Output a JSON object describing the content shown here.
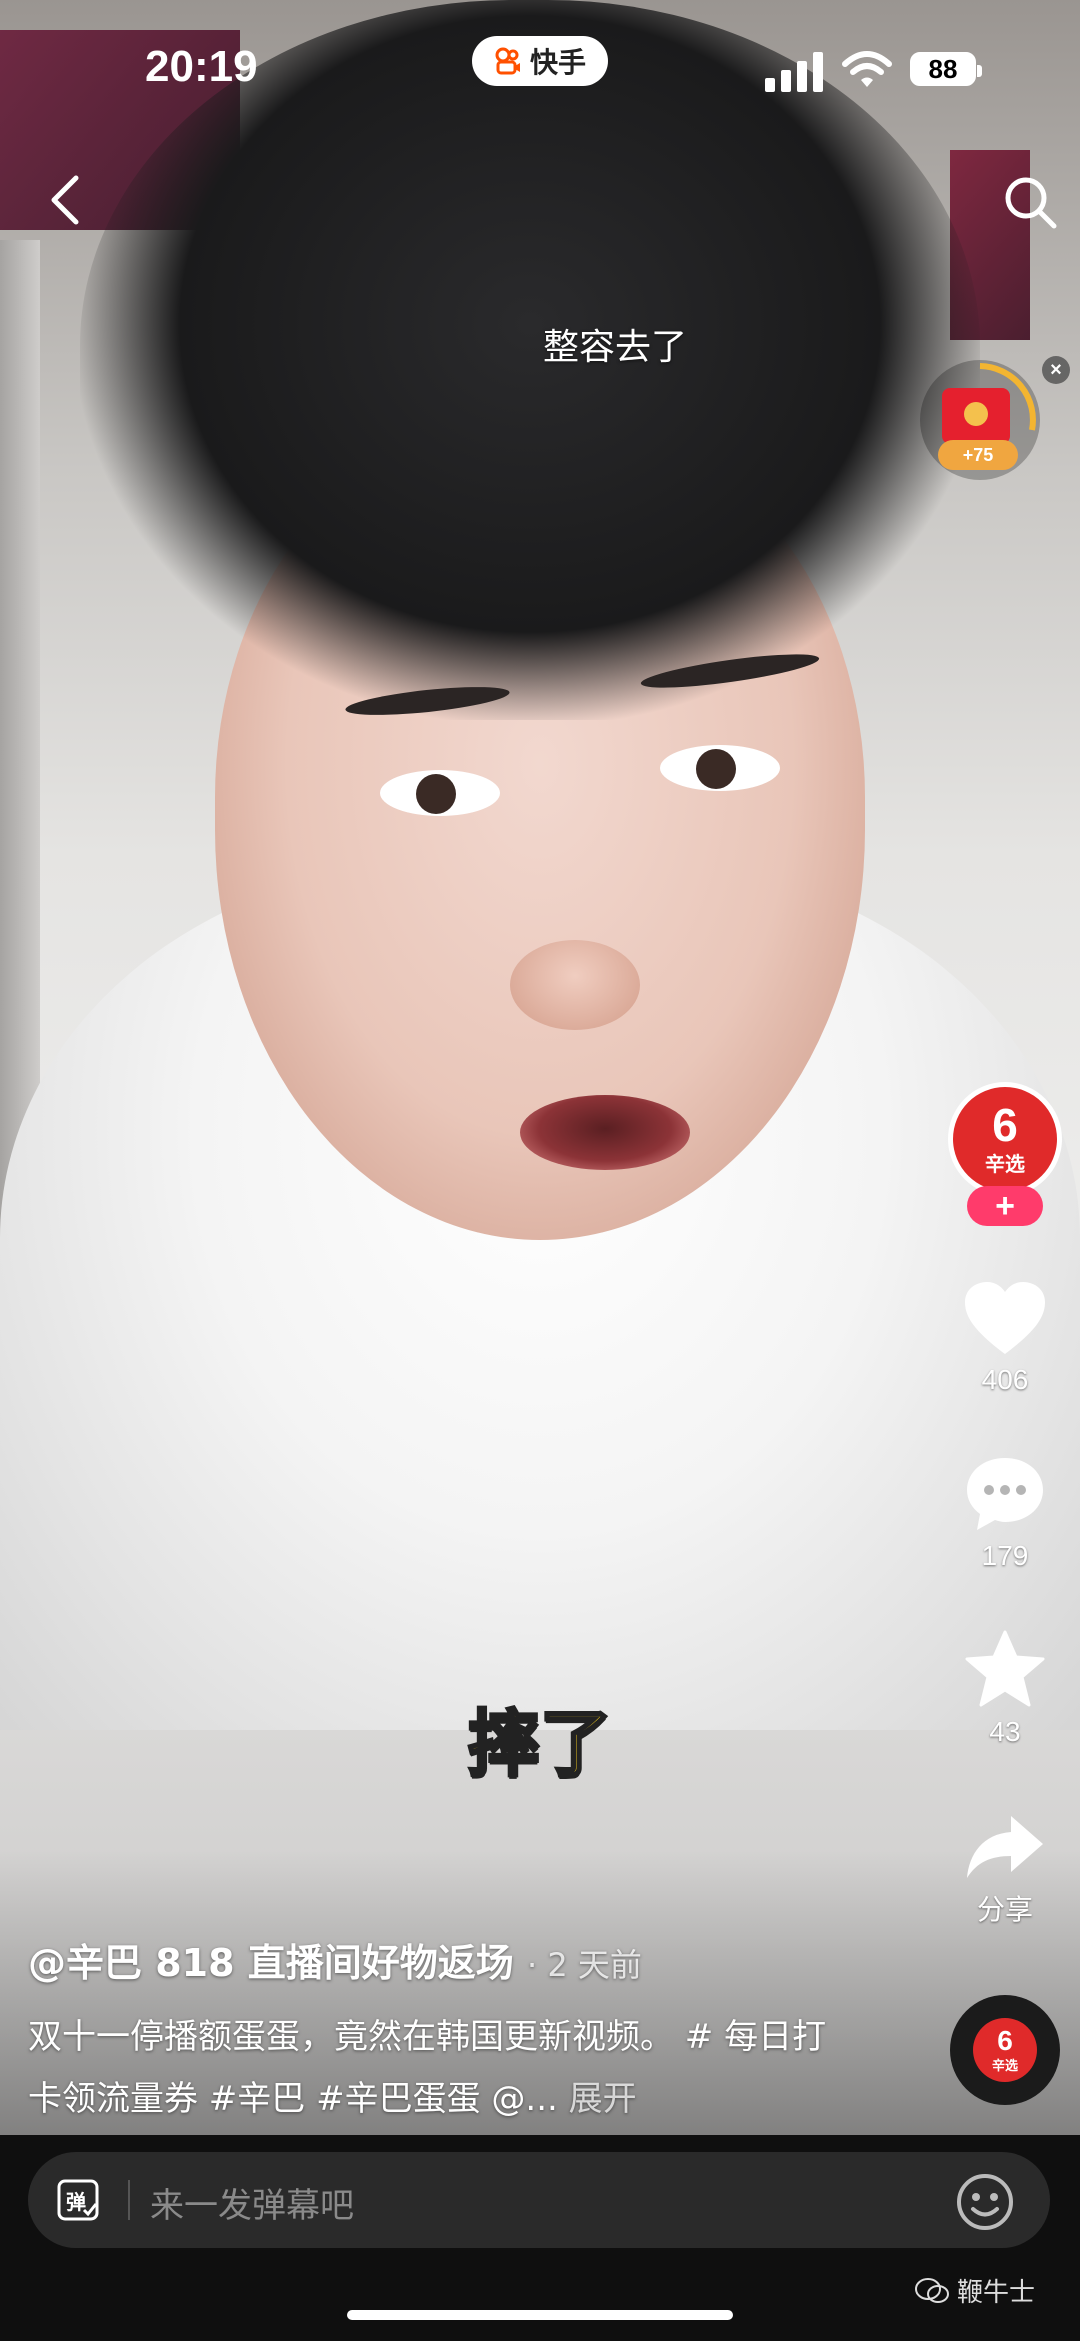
{
  "status_bar": {
    "time": "20:19",
    "app_name": "快手",
    "battery": "88"
  },
  "video": {
    "top_caption": "整容去了",
    "subtitle": "摔了"
  },
  "red_packet": {
    "bonus": "+75"
  },
  "creator": {
    "avatar_number": "6",
    "avatar_text": "辛选",
    "follow_label": "+"
  },
  "actions": {
    "likes": "406",
    "comments": "179",
    "favorites": "43",
    "share_label": "分享"
  },
  "post": {
    "author": "@辛巴 818 直播间好物返场",
    "posted": "· 2 天前",
    "description": "双十一停播额蛋蛋，竟然在韩国更新视频。 # 每日打卡领流量券 #辛巴 #辛巴蛋蛋 @...",
    "expand_label": " 展开"
  },
  "bottom": {
    "danmaku_icon_text": "弹",
    "placeholder": "来一发弹幕吧",
    "watermark": "鞭牛士"
  },
  "colors": {
    "brand_red": "#e02a2a",
    "follow_pink": "#ff3b6b",
    "subtitle_yellow": "#ffd51c",
    "kuaishou_orange": "#ff5000"
  },
  "icons": [
    "back-arrow-icon",
    "search-icon",
    "signal-icon",
    "wifi-icon",
    "heart-icon",
    "comment-icon",
    "star-icon",
    "share-arrow-icon",
    "danmaku-icon",
    "emoji-icon",
    "wechat-icon"
  ]
}
